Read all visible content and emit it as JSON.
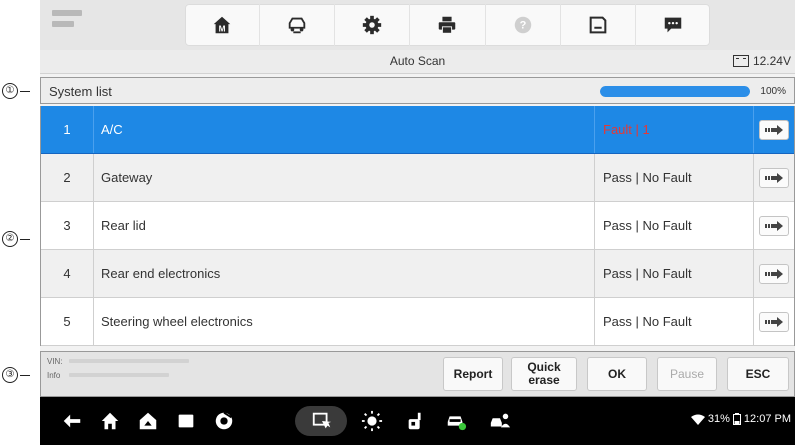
{
  "annotations": [
    "①",
    "②",
    "③"
  ],
  "toolbar": {
    "icons": [
      "home-icon",
      "vehicle-swap-icon",
      "settings-icon",
      "print-icon",
      "help-icon",
      "save-icon",
      "message-icon"
    ]
  },
  "titlebar": {
    "title": "Auto Scan",
    "voltage": "12.24V"
  },
  "system_list": {
    "label": "System list",
    "progress_percent": 100,
    "progress_text": "100%"
  },
  "rows": [
    {
      "num": "1",
      "name": "A/C",
      "status": "Fault | 1",
      "selected": true
    },
    {
      "num": "2",
      "name": "Gateway",
      "status": "Pass | No Fault"
    },
    {
      "num": "3",
      "name": "Rear lid",
      "status": "Pass | No Fault"
    },
    {
      "num": "4",
      "name": "Rear end electronics",
      "status": "Pass | No Fault"
    },
    {
      "num": "5",
      "name": "Steering wheel electronics",
      "status": "Pass | No Fault"
    }
  ],
  "functionbar": {
    "vin_label": "VIN:",
    "info_label": "Info",
    "report": "Report",
    "quick_erase_1": "Quick",
    "quick_erase_2": "erase",
    "ok": "OK",
    "pause": "Pause",
    "esc": "ESC"
  },
  "statusbar": {
    "battery_text": "31%",
    "time": "12:07 PM"
  },
  "colors": {
    "selected_row": "#1e88e5",
    "fault_text": "#e53935",
    "progress": "#2b8ee8"
  }
}
